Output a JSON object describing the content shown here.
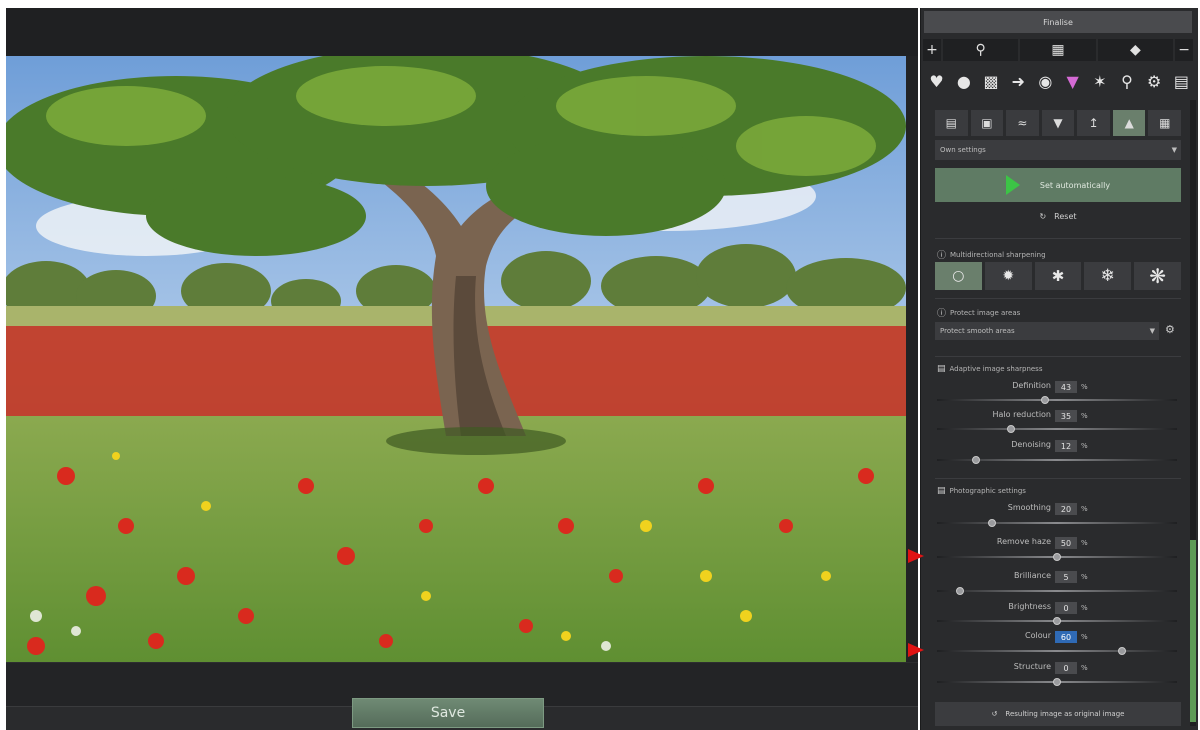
{
  "viewer": {
    "save_label": "Save"
  },
  "panel": {
    "title": "Finalise",
    "nav_icons": [
      "plus-icon",
      "search-icon",
      "compare-icon",
      "diamond-icon",
      "minus-icon"
    ],
    "tool_icons": [
      "heart-icon",
      "globe-icon",
      "image-icon",
      "brush-icon",
      "color-wheel-icon",
      "prism-icon",
      "network-icon",
      "magnifier-icon",
      "gear-icon",
      "document-icon"
    ],
    "preset": "Own settings",
    "auto_label": "Set automatically",
    "reset_label": "Reset",
    "multi_heading": "Multidirectional sharpening",
    "protect_heading": "Protect image areas",
    "protect_value": "Protect smooth areas",
    "adaptive_heading": "Adaptive image sharpness",
    "photographic_heading": "Photographic settings",
    "result_label": "Resulting image as original image",
    "colors": {
      "accent_green": "#5e9c57",
      "active_tab": "#6a7f6c",
      "highlight_value": "#2f6ab5",
      "arrow": "#e01313"
    }
  },
  "sliders": {
    "definition": {
      "label": "Definition",
      "value": "43",
      "unit": "%",
      "level": 0.45
    },
    "halo": {
      "label": "Halo reduction",
      "value": "35",
      "unit": "%",
      "level": 0.3
    },
    "denoise": {
      "label": "Denoising",
      "value": "12",
      "unit": "%",
      "level": 0.15
    },
    "smoothing": {
      "label": "Smoothing",
      "value": "20",
      "unit": "%",
      "level": 0.22
    },
    "haze": {
      "label": "Remove haze",
      "value": "50",
      "unit": "%",
      "level": 0.5
    },
    "brilliance": {
      "label": "Brilliance",
      "value": "5",
      "unit": "%",
      "level": 0.08
    },
    "brightness": {
      "label": "Brightness",
      "value": "0",
      "unit": "%",
      "level": 0.5
    },
    "colour": {
      "label": "Colour",
      "value": "60",
      "unit": "%",
      "level": 0.78
    },
    "structure": {
      "label": "Structure",
      "value": "0",
      "unit": "%",
      "level": 0.5
    }
  }
}
